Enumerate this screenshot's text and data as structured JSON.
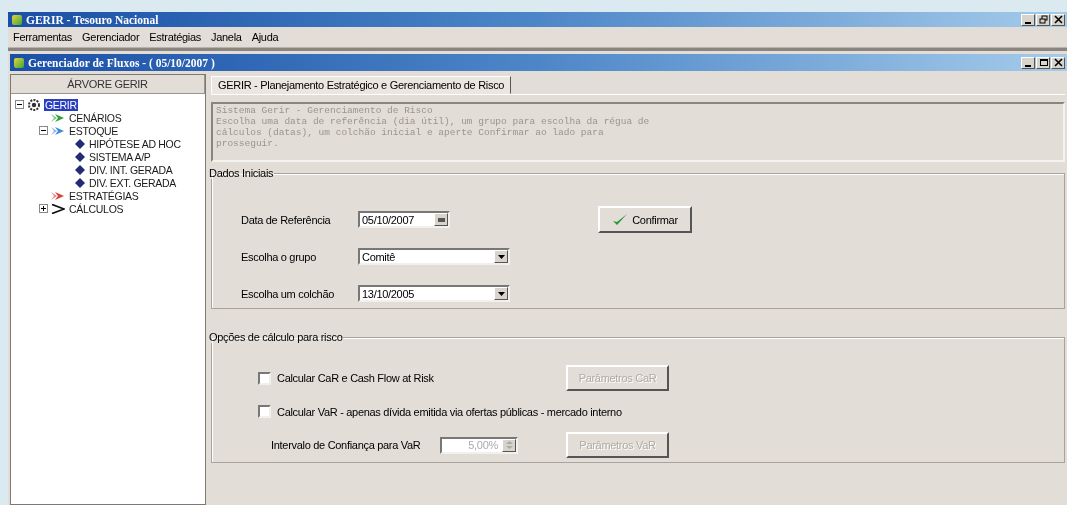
{
  "app_window": {
    "title": "GERIR - Tesouro Nacional"
  },
  "menu": [
    "Ferramentas",
    "Gerenciador",
    "Estratégias",
    "Janela",
    "Ajuda"
  ],
  "child_window": {
    "title": "Gerenciador de Fluxos - ( 05/10/2007 )"
  },
  "tree": {
    "header": "ÁRVORE GERIR",
    "items": [
      {
        "label": "GERIR",
        "kind": "gear",
        "color": "#333333",
        "selected": true,
        "expanded": true,
        "children": [
          {
            "label": "CENÁRIOS",
            "kind": "arrow",
            "color": "#2e9e3e",
            "selected": false
          },
          {
            "label": "ESTOQUE",
            "kind": "arrow",
            "color": "#3a8ad8",
            "selected": false,
            "expanded": true,
            "children": [
              {
                "label": "HIPÓTESE AD HOC",
                "kind": "diamond",
                "color": "#232a78",
                "selected": false
              },
              {
                "label": "SISTEMA A/P",
                "kind": "diamond",
                "color": "#232a78",
                "selected": false
              },
              {
                "label": "DIV. INT. GERADA",
                "kind": "diamond",
                "color": "#232a78",
                "selected": false
              },
              {
                "label": "DIV. EXT. GERADA",
                "kind": "diamond",
                "color": "#232a78",
                "selected": false
              }
            ]
          },
          {
            "label": "ESTRATÉGIAS",
            "kind": "arrow",
            "color": "#d8403a",
            "selected": false
          },
          {
            "label": "CÁLCULOS",
            "kind": "chevron",
            "color": "#111111",
            "selected": false,
            "expanded": false
          }
        ]
      }
    ]
  },
  "tabs": [
    {
      "label": "GERIR - Planejamento Estratégico e Gerenciamento de Risco",
      "selected": true
    }
  ],
  "description": "Sistema Gerir - Gerenciamento de Risco\nEscolha uma data de referência (dia útil), um grupo para escolha da régua de\ncálculos (datas), um colchão inicial e aperte Confirmar ao lado para\nprosseguir.",
  "initial_data": {
    "legend": "Dados Iniciais",
    "reference_date": {
      "label": "Data de Referência",
      "value": "05/10/2007"
    },
    "group": {
      "label": "Escolha o grupo",
      "value": "Comitê"
    },
    "cushion": {
      "label": "Escolha um colchão",
      "value": "13/10/2005"
    },
    "confirm_button": {
      "label": "Confirmar",
      "disabled": false
    }
  },
  "risk_options": {
    "legend": "Opções de cálculo para risco",
    "car_option": {
      "label": "Calcular CaR e Cash Flow at Risk",
      "checked": false
    },
    "car_button": {
      "label": "Parâmetros CaR",
      "disabled": true
    },
    "var_option": {
      "label": "Calcular VaR - apenas dívida emitida via ofertas públicas - mercado interno",
      "checked": false
    },
    "confidence": {
      "label": "Intervalo de Confiança para VaR",
      "value": "5,00%",
      "disabled": true
    },
    "var_button": {
      "label": "Parâmetros VaR",
      "disabled": true
    }
  }
}
